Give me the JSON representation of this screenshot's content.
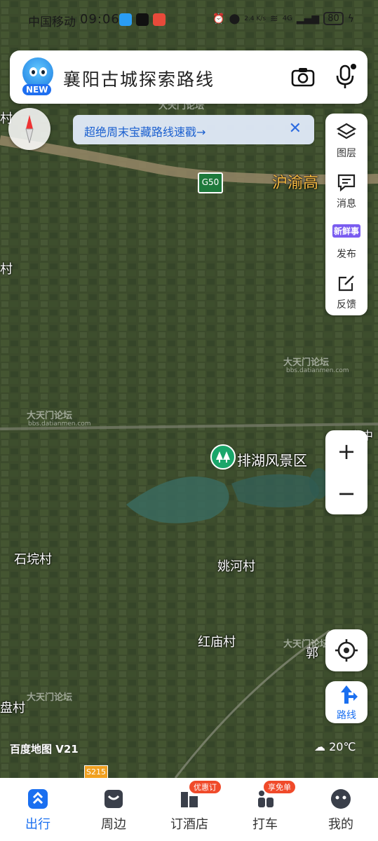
{
  "status_bar": {
    "carrier": "中国移动",
    "time": "09:06",
    "net_speed": "2.4 K/s",
    "network": "4G",
    "battery": "80"
  },
  "search": {
    "mascot_badge": "NEW",
    "query": "襄阳古城探索路线",
    "camera_icon": "camera-icon",
    "mic_icon": "microphone-icon"
  },
  "banner": {
    "text": "超绝周末宝藏路线速戳→",
    "close": "✕"
  },
  "side_panel": [
    {
      "icon": "layers-icon",
      "label": "图层"
    },
    {
      "icon": "message-icon",
      "label": "消息"
    },
    {
      "icon": "fresh-news-icon",
      "label": "发布",
      "badge": "新鲜事"
    },
    {
      "icon": "feedback-icon",
      "label": "反馈"
    }
  ],
  "zoom": {
    "in": "+",
    "out": "−"
  },
  "route_button": {
    "label": "路线"
  },
  "map": {
    "road_shield": "G50",
    "road_shield_2": "S215",
    "highway_label": "沪渝高",
    "scenic_spot": "排湖风景区",
    "places": [
      "石垸村",
      "姚河村",
      "红庙村",
      "盘村",
      "村",
      "村",
      "郭",
      "兴中"
    ],
    "logo": "百度地图 V21",
    "weather": "20℃",
    "watermark": "大天门论坛",
    "watermark_url": "bbs.datianmen.com"
  },
  "tabs": [
    {
      "label": "出行",
      "active": true
    },
    {
      "label": "周边"
    },
    {
      "label": "订酒店",
      "promo": "优惠订"
    },
    {
      "label": "打车",
      "promo": "享免单"
    },
    {
      "label": "我的"
    }
  ],
  "colors": {
    "accent": "#1a6ff0",
    "promo": "#f04a2a",
    "scenic": "#1aa66a",
    "highway_label": "#f5b942"
  }
}
